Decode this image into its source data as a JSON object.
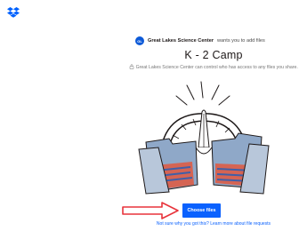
{
  "brand": {
    "logo_icon": "dropbox-icon",
    "color": "#0061fe"
  },
  "request": {
    "avatar_initials": "GL",
    "org_name": "Great Lakes Science Center",
    "action_text": "wants you to add files",
    "title": "K - 2 Camp",
    "privacy_note": "Great Lakes Science Center can control who has access to any files you share."
  },
  "upload": {
    "button_label": "Choose files",
    "button_color": "#0a61fe",
    "annotation_arrow_color": "#e8333b"
  },
  "footer": {
    "question": "Not sure why you got this?",
    "link_label": "Learn more about file requests"
  }
}
